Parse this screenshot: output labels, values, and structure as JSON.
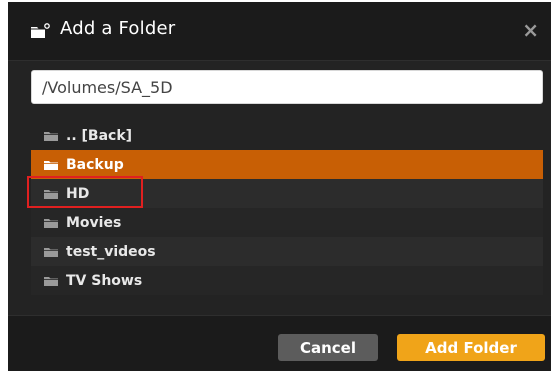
{
  "dialog": {
    "title": "Add a Folder",
    "close_label": "×",
    "header_icon": "folder-plus-icon"
  },
  "path_field": {
    "value": "/Volumes/SA_5D"
  },
  "folders": [
    {
      "label": ".. [Back]",
      "icon": "folder-icon",
      "selected": false
    },
    {
      "label": "Backup",
      "icon": "folder-open-icon",
      "selected": true
    },
    {
      "label": "HD",
      "icon": "folder-icon",
      "selected": false
    },
    {
      "label": "Movies",
      "icon": "folder-icon",
      "selected": false
    },
    {
      "label": "test_videos",
      "icon": "folder-icon",
      "selected": false
    },
    {
      "label": "TV Shows",
      "icon": "folder-icon",
      "selected": false
    }
  ],
  "buttons": {
    "cancel_label": "Cancel",
    "add_label": "Add Folder"
  },
  "colors": {
    "accent": "#f0a419",
    "selected_row": "#c85f05",
    "annotation": "#e02020"
  }
}
